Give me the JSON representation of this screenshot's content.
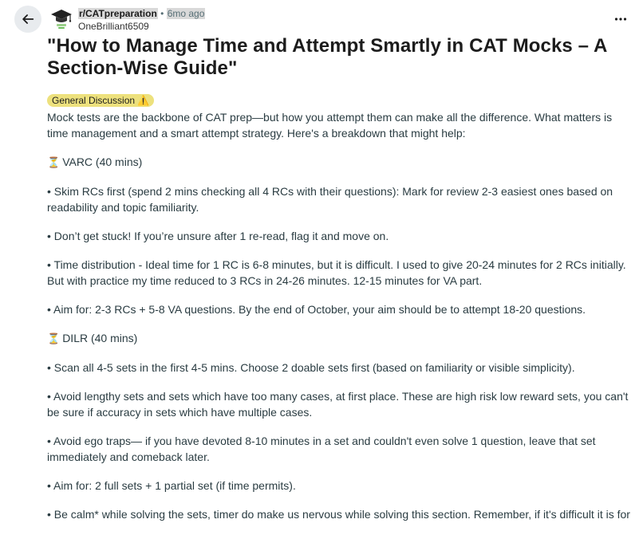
{
  "header": {
    "subreddit": "r/CATpreparation",
    "separator": "•",
    "time_ago": "6mo ago",
    "username": "OneBrilliant6509"
  },
  "icons": {
    "back": "arrow-left-icon",
    "more": "more-horizontal-icon",
    "avatar": "graduation-cap-avatar",
    "section_marker": "hourglass-icon",
    "flair_icon": "warning-icon"
  },
  "post": {
    "title": "\"How to Manage Time and Attempt Smartly in CAT Mocks – A Section-Wise Guide\"",
    "flair": "General Discussion",
    "flair_emoji": "⚠️",
    "flair_color": "#ede17d",
    "paragraphs": [
      "Mock tests are the backbone of CAT prep—but how you attempt them can make all the difference. What matters is time management and a smart attempt strategy. Here's a breakdown that might help:",
      "VARC (40 mins)",
      "• Skim RCs first (spend 2 mins checking all 4 RCs with their questions): Mark for review 2-3 easiest ones based on readability and topic familiarity.",
      "• Don’t get stuck! If you’re unsure after 1 re-read, flag it and move on.",
      "• Time distribution - Ideal time for 1 RC is 6-8 minutes, but it is difficult. I used to give 20-24 minutes for 2 RCs initially. But with practice my time reduced to 3 RCs in 24-26 minutes. 12-15 minutes for VA part.",
      "• Aim for: 2-3 RCs + 5-8 VA questions. By the end of October, your aim should be to attempt 18-20 questions.",
      "DILR (40 mins)",
      "• Scan all 4-5 sets in the first 4-5 mins. Choose 2 doable sets first (based on familiarity or visible simplicity).",
      "• Avoid lengthy sets and sets which have too many cases, at first place. These are high risk low reward sets, you can't be sure if accuracy in sets which have multiple cases.",
      "• Avoid ego traps— if you have devoted 8-10 minutes in a set and couldn't even solve 1 question, leave that set immediately and comeback later.",
      "• Aim for: 2 full sets + 1 partial set (if time permits).",
      "• Be calm* while solving the sets, timer do make us nervous while solving this section. Remember, if it's difficult it is for"
    ],
    "section_marker_glyph": "⏳"
  }
}
